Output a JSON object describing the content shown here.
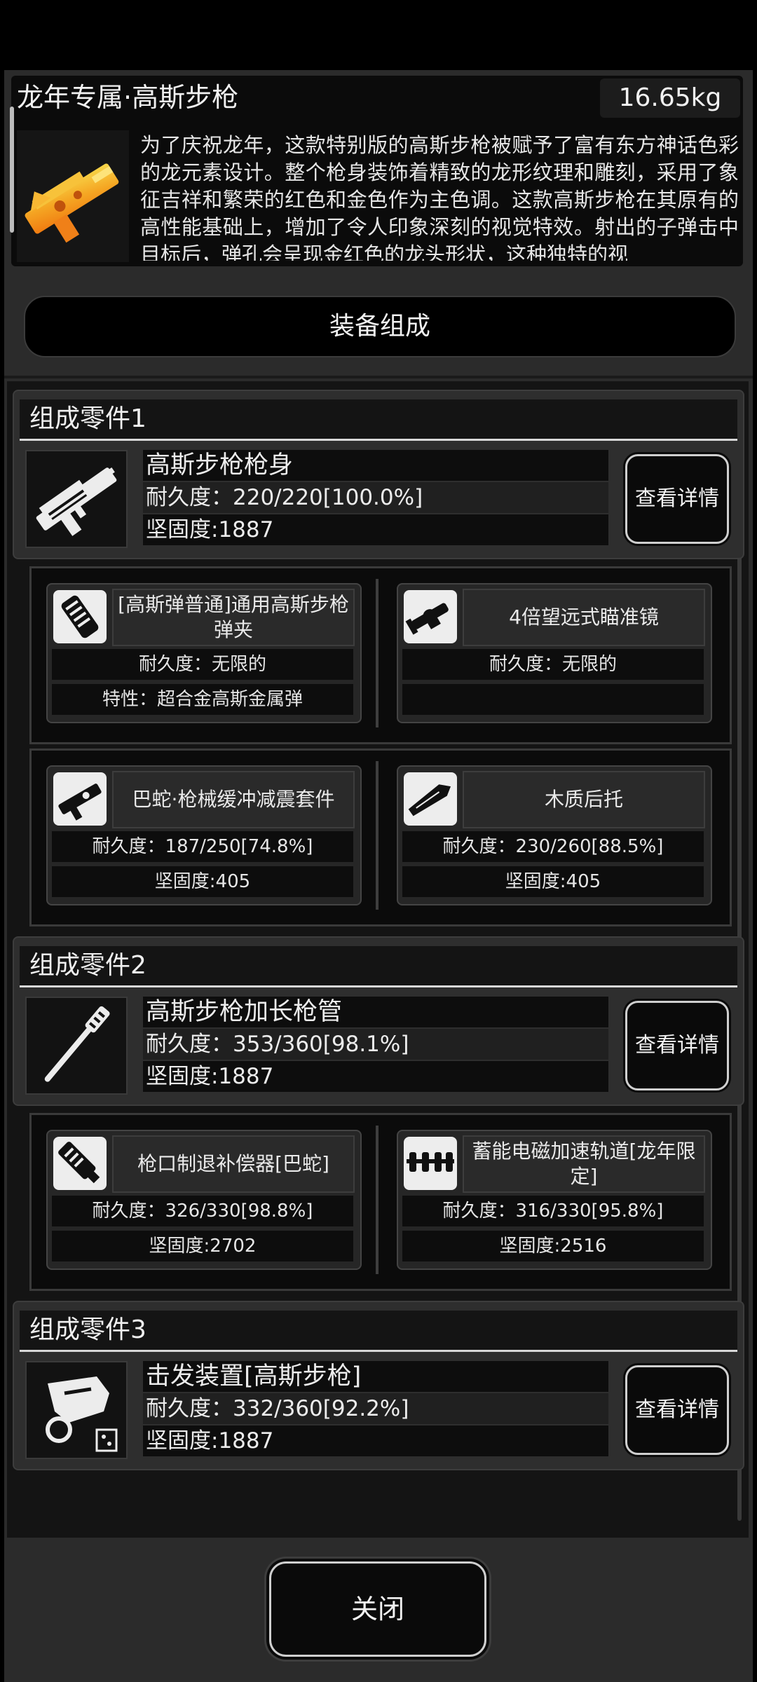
{
  "item": {
    "title": "龙年专属·高斯步枪",
    "weight": "16.65kg",
    "description": "为了庆祝龙年，这款特别版的高斯步枪被赋予了富有东方神话色彩的龙元素设计。整个枪身装饰着精致的龙形纹理和雕刻，采用了象征吉祥和繁荣的红色和金色作为主色调。这款高斯步枪在其原有的高性能基础上，增加了令人印象深刻的视觉特效。射出的子弹击中目标后，弹孔会呈现金红色的龙头形状，这种独特的视",
    "icon": "golden-dragon-rifle-icon"
  },
  "composition_button": "装备组成",
  "groups": [
    {
      "title": "组成零件1",
      "name": "高斯步枪枪身",
      "durability": "耐久度：220/220[100.0%]",
      "hardness": "坚固度:1887",
      "detail_label": "查看详情",
      "icon": "rifle-body-icon",
      "subs": [
        {
          "name": "[高斯弹普通]通用高斯步枪弹夹",
          "row1": "耐久度：无限的",
          "row2": "特性：超合金高斯金属弹",
          "icon": "magazine-icon"
        },
        {
          "name": "4倍望远式瞄准镜",
          "row1": "耐久度：无限的",
          "row2": "",
          "icon": "scope-icon"
        },
        {
          "name": "巴蛇·枪械缓冲减震套件",
          "row1": "耐久度：187/250[74.8%]",
          "row2": "坚固度:405",
          "icon": "buffer-kit-icon"
        },
        {
          "name": "木质后托",
          "row1": "耐久度：230/260[88.5%]",
          "row2": "坚固度:405",
          "icon": "wooden-stock-icon"
        }
      ]
    },
    {
      "title": "组成零件2",
      "name": "高斯步枪加长枪管",
      "durability": "耐久度：353/360[98.1%]",
      "hardness": "坚固度:1887",
      "detail_label": "查看详情",
      "icon": "barrel-icon",
      "subs": [
        {
          "name": "枪口制退补偿器[巴蛇]",
          "row1": "耐久度：326/330[98.8%]",
          "row2": "坚固度:2702",
          "icon": "muzzle-brake-icon"
        },
        {
          "name": "蓄能电磁加速轨道[龙年限定]",
          "row1": "耐久度：316/330[95.8%]",
          "row2": "坚固度:2516",
          "icon": "rail-icon"
        }
      ]
    },
    {
      "title": "组成零件3",
      "name": "击发装置[高斯步枪]",
      "durability": "耐久度：332/360[92.2%]",
      "hardness": "坚固度:1887",
      "detail_label": "查看详情",
      "icon": "trigger-assembly-icon"
    }
  ],
  "close_button": "关闭",
  "colors": {
    "background": "#2b2b2b",
    "card": "#2e2e2e",
    "dark": "#0d0d0d",
    "accent_gold": "#f0a020"
  }
}
